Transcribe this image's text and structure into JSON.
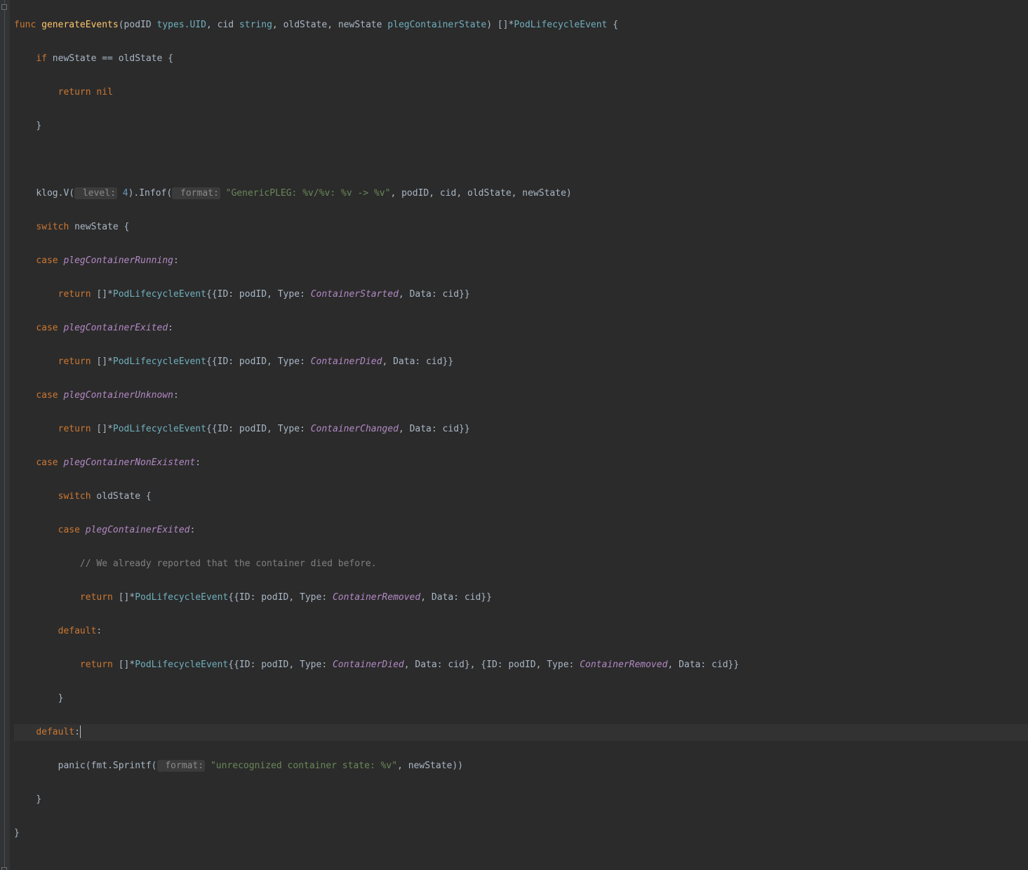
{
  "code": {
    "l1": {
      "func": "func",
      "name": "generateEvents",
      "p_podID": "podID",
      "t_types_uid": "types.UID",
      "p_cid": "cid",
      "t_string": "string",
      "p_oldState": "oldState",
      "p_newState": "newState",
      "t_plegContainerState": "plegContainerState",
      "ret_brackets": "[]*",
      "ret_type": "PodLifecycleEvent",
      "brace": " {"
    },
    "l2": {
      "if": "if",
      "expr": " newState == oldState {"
    },
    "l3": {
      "return": "return",
      "nil": "nil"
    },
    "l4": {
      "brace": "}"
    },
    "l5": "",
    "l6": {
      "klog": "klog.V(",
      "hint_level": " level:",
      "level_num": "4",
      "infof": ").Infof(",
      "hint_format": " format:",
      "fmtstr": "\"GenericPLEG: %v/%v: %v -> %v\"",
      "args": ", podID, cid, oldState, newState)"
    },
    "l7": {
      "switch": "switch",
      "expr": " newState {"
    },
    "l8": {
      "case": "case",
      "val": "plegContainerRunning",
      "colon": ":"
    },
    "l9": {
      "return": "return",
      "br": " []*",
      "type": "PodLifecycleEvent",
      "open": "{{ID: podID, Type: ",
      "econst": "ContainerStarted",
      "rest": ", Data: cid}}"
    },
    "l10": {
      "case": "case",
      "val": "plegContainerExited",
      "colon": ":"
    },
    "l11": {
      "return": "return",
      "br": " []*",
      "type": "PodLifecycleEvent",
      "open": "{{ID: podID, Type: ",
      "econst": "ContainerDied",
      "rest": ", Data: cid}}"
    },
    "l12": {
      "case": "case",
      "val": "plegContainerUnknown",
      "colon": ":"
    },
    "l13": {
      "return": "return",
      "br": " []*",
      "type": "PodLifecycleEvent",
      "open": "{{ID: podID, Type: ",
      "econst": "ContainerChanged",
      "rest": ", Data: cid}}"
    },
    "l14": {
      "case": "case",
      "val": "plegContainerNonExistent",
      "colon": ":"
    },
    "l15": {
      "switch": "switch",
      "expr": " oldState {"
    },
    "l16": {
      "case": "case",
      "val": "plegContainerExited",
      "colon": ":"
    },
    "l17": {
      "cmt": "// We already reported that the container died before."
    },
    "l18": {
      "return": "return",
      "br": " []*",
      "type": "PodLifecycleEvent",
      "open": "{{ID: podID, Type: ",
      "econst": "ContainerRemoved",
      "rest": ", Data: cid}}"
    },
    "l19": {
      "default": "default",
      "colon": ":"
    },
    "l20": {
      "return": "return",
      "br": " []*",
      "type": "PodLifecycleEvent",
      "open": "{{ID: podID, Type: ",
      "econst1": "ContainerDied",
      "mid": ", Data: cid}, {ID: podID, Type: ",
      "econst2": "ContainerRemoved",
      "rest": ", Data: cid}}"
    },
    "l21": {
      "brace": "}"
    },
    "l22": {
      "default": "default",
      "colon": ":"
    },
    "l23": {
      "panic": "panic",
      "open": "(fmt.Sprintf(",
      "hint_format": " format:",
      "fmtstr": "\"unrecognized container state: %v\"",
      "args": ", newState))"
    },
    "l24": {
      "brace": "}"
    },
    "l25": {
      "brace": "}"
    }
  },
  "indent": {
    "i0": "",
    "i1": "    ",
    "i2": "        ",
    "i3": "            "
  }
}
